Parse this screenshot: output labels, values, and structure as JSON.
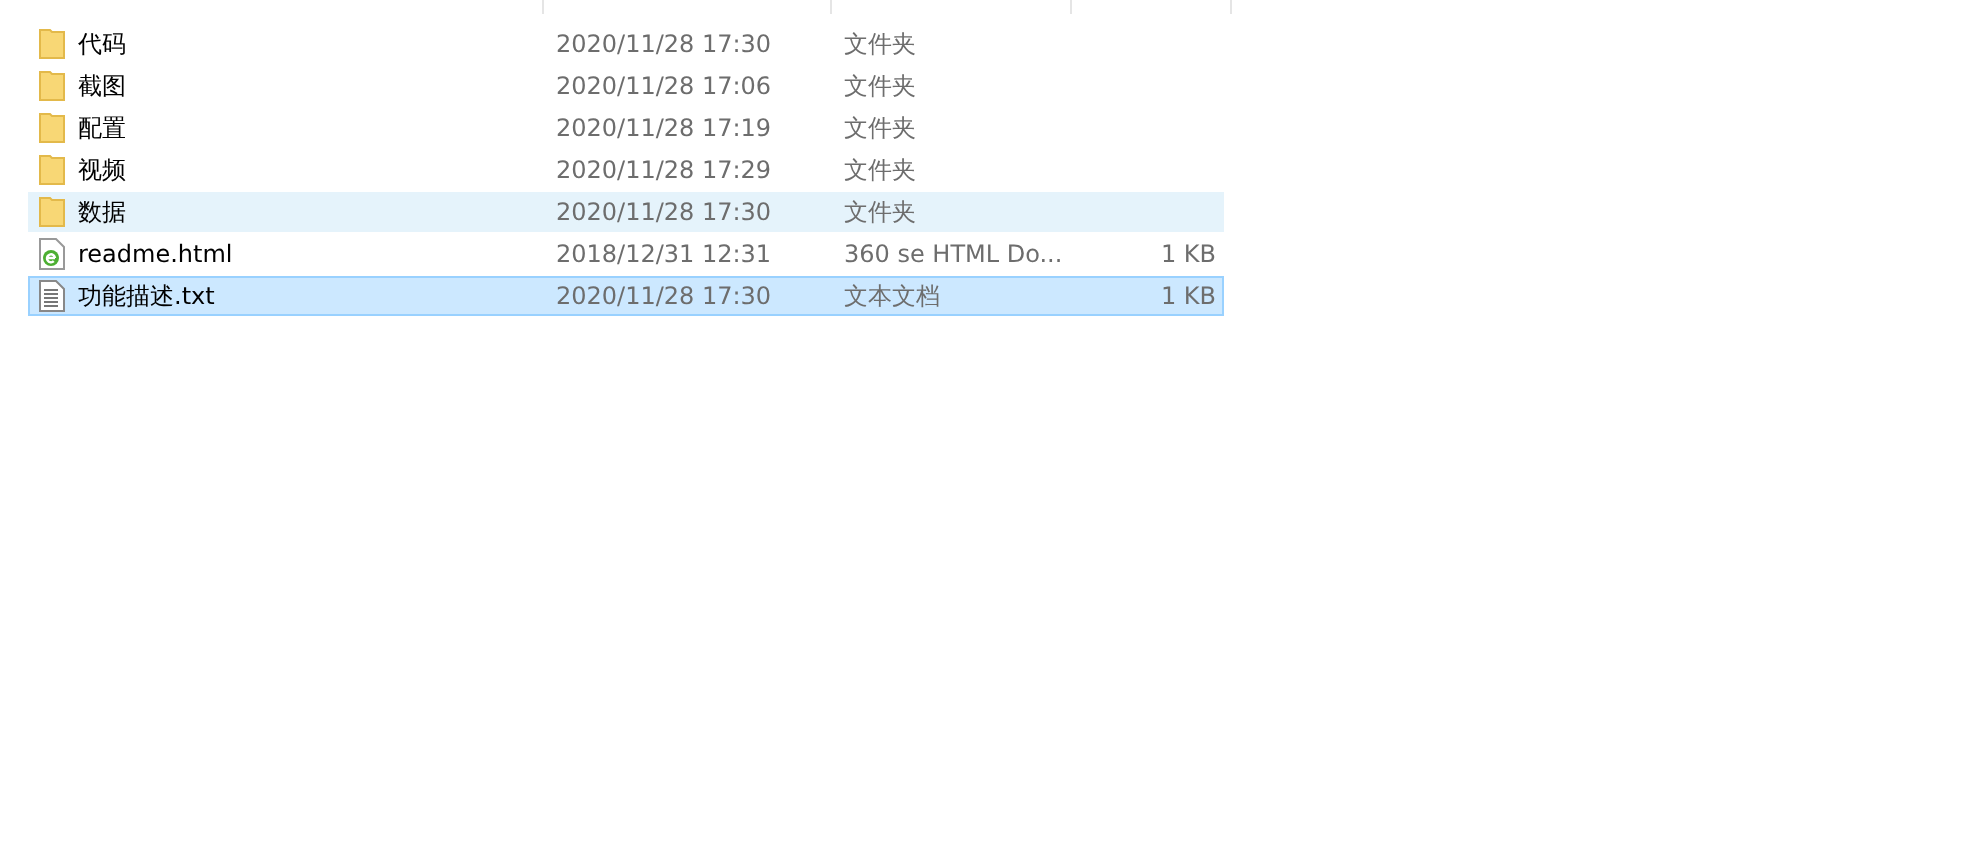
{
  "files": [
    {
      "name": "代码",
      "modified": "2020/11/28 17:30",
      "type": "文件夹",
      "kind": "folder",
      "selected": false,
      "hovered": false
    },
    {
      "name": "截图",
      "modified": "2020/11/28 17:06",
      "type": "文件夹",
      "kind": "folder",
      "selected": false,
      "hovered": false
    },
    {
      "name": "配置",
      "modified": "2020/11/28 17:19",
      "type": "文件夹",
      "kind": "folder",
      "selected": false,
      "hovered": false
    },
    {
      "name": "视频",
      "modified": "2020/11/28 17:29",
      "type": "文件夹",
      "kind": "folder",
      "selected": false,
      "hovered": false
    },
    {
      "name": "数据",
      "modified": "2020/11/28 17:30",
      "type": "文件夹",
      "kind": "folder",
      "selected": false,
      "hovered": true
    },
    {
      "name": "readme.html",
      "modified": "2018/12/31 12:31",
      "type": "360 se HTML Do...",
      "size": "1 KB",
      "kind": "html",
      "selected": false,
      "hovered": false
    },
    {
      "name": "功能描述.txt",
      "modified": "2020/11/28 17:30",
      "type": "文本文档",
      "size": "1 KB",
      "kind": "text",
      "selected": true,
      "hovered": false
    }
  ]
}
